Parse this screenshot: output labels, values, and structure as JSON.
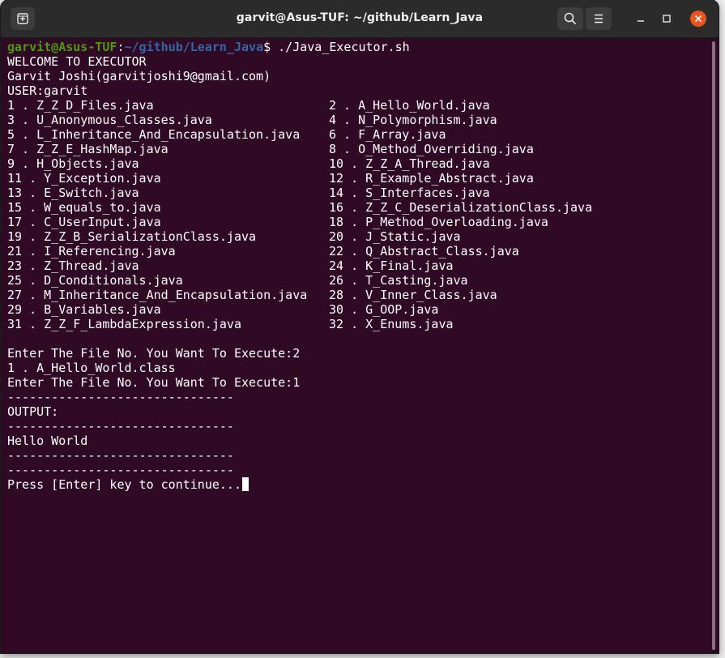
{
  "window": {
    "title": "garvit@Asus-TUF: ~/github/Learn_Java"
  },
  "prompt": {
    "user_host": "garvit@Asus-TUF",
    "separator": ":",
    "path": "~/github/Learn_Java",
    "symbol": "$",
    "command": " ./Java_Executor.sh"
  },
  "header_lines": [
    "WELCOME TO EXECUTOR",
    "Garvit Joshi(garvitjoshi9@gmail.com)",
    "USER:garvit"
  ],
  "file_rows": [
    [
      "1 . Z_Z_D_Files.java",
      "2 . A_Hello_World.java"
    ],
    [
      "3 . U_Anonymous_Classes.java",
      "4 . N_Polymorphism.java"
    ],
    [
      "5 . L_Inheritance_And_Encapsulation.java",
      "6 . F_Array.java"
    ],
    [
      "7 . Z_Z_E_HashMap.java",
      "8 . O_Method_Overriding.java"
    ],
    [
      "9 . H_Objects.java",
      "10 . Z_Z_A_Thread.java"
    ],
    [
      "11 . Y_Exception.java",
      "12 . R_Example_Abstract.java"
    ],
    [
      "13 . E_Switch.java",
      "14 . S_Interfaces.java"
    ],
    [
      "15 . W_equals_to.java",
      "16 . Z_Z_C_DeserializationClass.java"
    ],
    [
      "17 . C_UserInput.java",
      "18 . P_Method_Overloading.java"
    ],
    [
      "19 . Z_Z_B_SerializationClass.java",
      "20 . J_Static.java"
    ],
    [
      "21 . I_Referencing.java",
      "22 . Q_Abstract_Class.java"
    ],
    [
      "23 . Z_Thread.java",
      "24 . K_Final.java"
    ],
    [
      "25 . D_Conditionals.java",
      "26 . T_Casting.java"
    ],
    [
      "27 . M_Inheritance_And_Encapsulation.java",
      "28 . V_Inner_Class.java"
    ],
    [
      "29 . B_Variables.java",
      "30 . G_OOP.java"
    ],
    [
      "31 . Z_Z_F_LambdaExpression.java",
      "32 . X_Enums.java"
    ]
  ],
  "output_lines": [
    "",
    "Enter The File No. You Want To Execute:2",
    "1 . A_Hello_World.class",
    "Enter The File No. You Want To Execute:1",
    "-------------------------------",
    "OUTPUT:",
    "-------------------------------",
    "Hello World",
    "-------------------------------",
    "-------------------------------"
  ],
  "final_line": "Press [Enter] key to continue...",
  "colors": {
    "terminal_bg": "#300a24",
    "prompt_user": "#4e9a06",
    "prompt_path": "#3465a4",
    "titlebar_bg": "#2b2b2b",
    "close_button": "#e95420"
  },
  "icons": {
    "new_tab": "new-tab-icon",
    "search": "search-icon",
    "menu": "hamburger-menu-icon",
    "minimize": "minimize-icon",
    "maximize": "maximize-icon",
    "close": "close-icon"
  }
}
